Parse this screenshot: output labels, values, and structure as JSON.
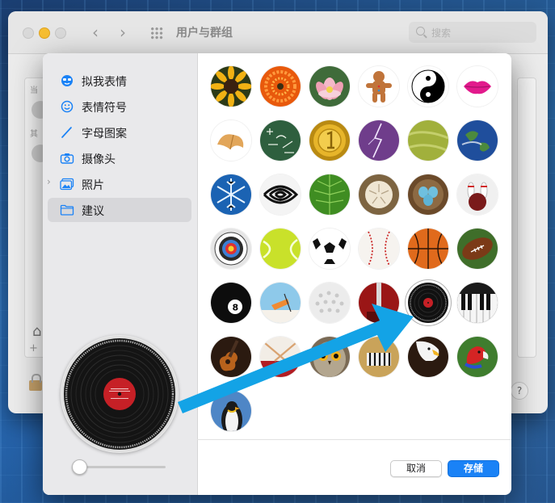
{
  "window": {
    "title": "用户与群组",
    "search_placeholder": "搜索",
    "side_labels": [
      "当",
      "其"
    ],
    "help_label": "?",
    "home_icon": "house-icon",
    "add_label": "+"
  },
  "sidebar": {
    "items": [
      {
        "label": "拟我表情",
        "icon": "memoji-icon"
      },
      {
        "label": "表情符号",
        "icon": "emoji-smiley-icon"
      },
      {
        "label": "字母图案",
        "icon": "pencil-icon"
      },
      {
        "label": "摄像头",
        "icon": "camera-icon"
      },
      {
        "label": "照片",
        "icon": "photos-icon",
        "expandable": true
      },
      {
        "label": "建议",
        "icon": "folder-icon",
        "selected": true
      }
    ]
  },
  "pictures": [
    "sunflower",
    "dahlia",
    "lotus",
    "gingerbread-man",
    "yin-yang",
    "lips",
    "fortune-cookie",
    "chalkboard",
    "gold-medal",
    "lightning",
    "sand",
    "earth",
    "snowflake",
    "zebra-pattern",
    "leaf",
    "sand-dollar",
    "eggs-nest",
    "bowling",
    "target",
    "tennis-ball",
    "soccer-ball",
    "baseball",
    "basketball",
    "football",
    "eight-ball",
    "drink",
    "golf-ball",
    "guitar-amp",
    "vinyl-record",
    "piano-keys",
    "guitar",
    "drum",
    "owl",
    "zebra",
    "eagle",
    "parrot",
    "penguin"
  ],
  "selected_picture": "vinyl-record",
  "preview": {
    "picture": "vinyl-record",
    "zoom": 0
  },
  "footer": {
    "cancel_label": "取消",
    "save_label": "存储"
  },
  "colors": {
    "accent": "#1a82f6",
    "annotation_arrow": "#13a3e6"
  }
}
